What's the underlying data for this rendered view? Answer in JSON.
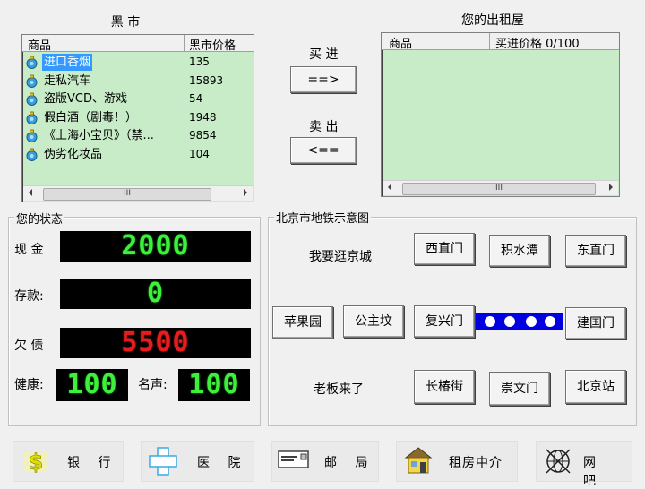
{
  "black_market": {
    "title": "黑 市",
    "col_item": "商品",
    "col_price": "黑市价格",
    "items": [
      {
        "name": "进口香烟",
        "price": "135"
      },
      {
        "name": "走私汽车",
        "price": "15893"
      },
      {
        "name": "盗版VCD、游戏",
        "price": "54"
      },
      {
        "name": "假白酒（剧毒！）",
        "price": "1948"
      },
      {
        "name": "《上海小宝贝》（禁...",
        "price": "9854"
      },
      {
        "name": "伪劣化妆品",
        "price": "104"
      }
    ],
    "scroll_thumb": "III"
  },
  "trade": {
    "buy_label": "买 进",
    "buy_button": "==>",
    "sell_label": "卖 出",
    "sell_button": "<=="
  },
  "rental": {
    "title": "您的出租屋",
    "col_item": "商品",
    "col_price": "买进价格 0/100",
    "scroll_thumb": "III"
  },
  "status": {
    "legend": "您的状态",
    "cash_label": "现 金",
    "cash_value": "2000",
    "deposit_label": "存款:",
    "deposit_value": "0",
    "debt_label": "欠 债",
    "debt_value": "5500",
    "health_label": "健康:",
    "health_value": "100",
    "fame_label": "名声:",
    "fame_value": "100"
  },
  "metro": {
    "legend": "北京市地铁示意图",
    "text_visit": "我要逛京城",
    "text_boss": "老板来了",
    "stations": {
      "xizhimen": "西直门",
      "jishuitan": "积水潭",
      "dongzhimen": "东直门",
      "pingguoyuan": "苹果园",
      "gongzhufen": "公主坟",
      "fuxingmen": "复兴门",
      "jianguomen": "建国门",
      "changchunjie": "长椿街",
      "chongwenmen": "崇文门",
      "beijingzhan": "北京站"
    },
    "line_color": "#0000e0"
  },
  "bottom_bar": {
    "bank": "银 行",
    "hospital": "医 院",
    "post_office": "邮 局",
    "rental_agency": "租房中介",
    "internet_cafe": "网 吧"
  }
}
